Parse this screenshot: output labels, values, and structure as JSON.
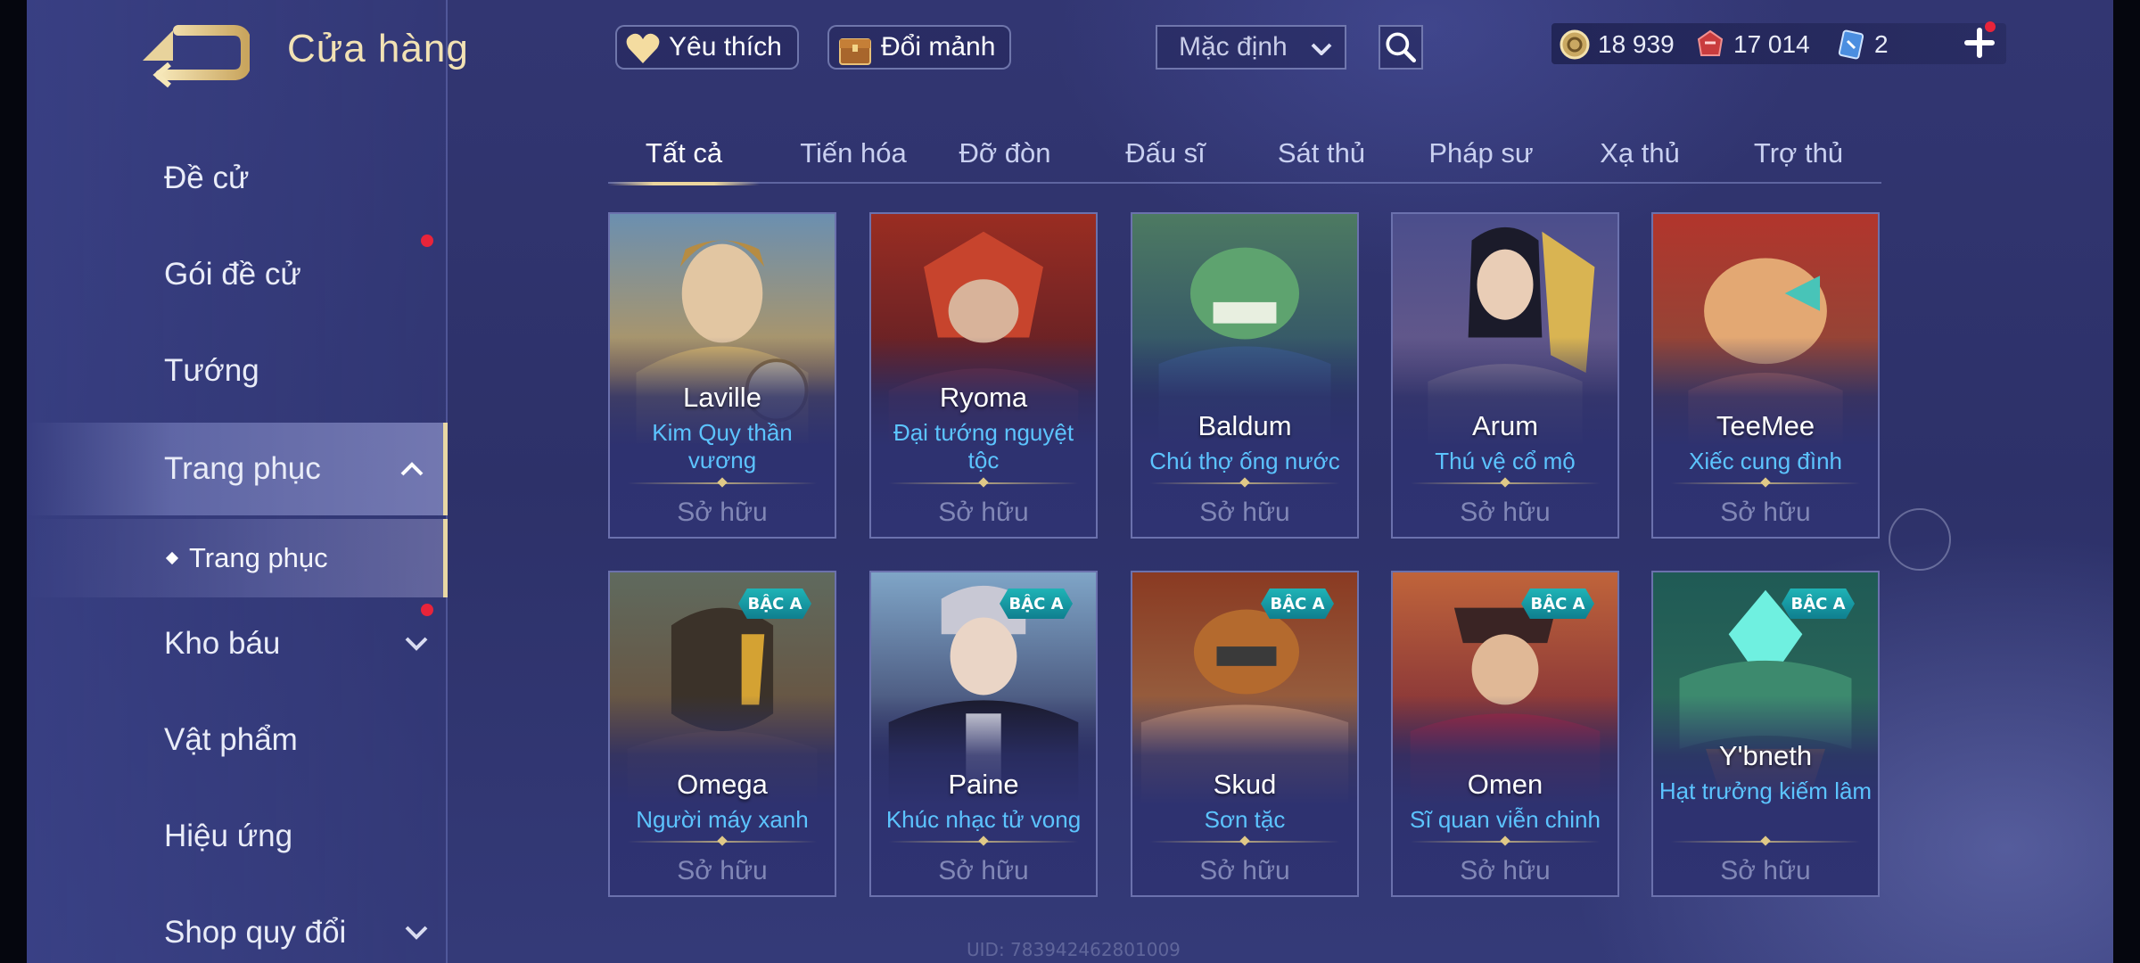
{
  "header": {
    "title": "Cửa hàng"
  },
  "sidebar": {
    "items": [
      {
        "label": "Đề cử"
      },
      {
        "label": "Gói đề cử"
      },
      {
        "label": "Tướng"
      },
      {
        "label": "Trang phục"
      },
      {
        "label": "Kho báu"
      },
      {
        "label": "Vật phẩm"
      },
      {
        "label": "Hiệu ứng"
      },
      {
        "label": "Shop quy đổi"
      }
    ],
    "sub_item": "Trang phục"
  },
  "topbar": {
    "favorite_label": "Yêu thích",
    "exchange_label": "Đổi mảnh",
    "sort_selected": "Mặc định"
  },
  "currencies": {
    "gold": "18 939",
    "vouchers": "17 014",
    "tickets": "2"
  },
  "tabs": [
    "Tất cả",
    "Tiến hóa",
    "Đỡ đòn",
    "Đấu sĩ",
    "Sát thủ",
    "Pháp sư",
    "Xạ thủ",
    "Trợ thủ"
  ],
  "skins": [
    {
      "hero": "Laville",
      "skin": "Kim Quy thần vương",
      "status": "Sở hữu"
    },
    {
      "hero": "Ryoma",
      "skin": "Đại tướng nguyệt tộc",
      "status": "Sở hữu"
    },
    {
      "hero": "Baldum",
      "skin": "Chú thợ ống nước",
      "status": "Sở hữu"
    },
    {
      "hero": "Arum",
      "skin": "Thú vệ cổ mộ",
      "status": "Sở hữu"
    },
    {
      "hero": "TeeMee",
      "skin": "Xiếc cung đình",
      "status": "Sở hữu"
    },
    {
      "hero": "Omega",
      "skin": "Người máy xanh",
      "status": "Sở hữu",
      "badge": "BẬC A"
    },
    {
      "hero": "Paine",
      "skin": "Khúc nhạc tử vong",
      "status": "Sở hữu",
      "badge": "BẬC A"
    },
    {
      "hero": "Skud",
      "skin": "Sơn tặc",
      "status": "Sở hữu",
      "badge": "BẬC A"
    },
    {
      "hero": "Omen",
      "skin": "Sĩ quan viễn chinh",
      "status": "Sở hữu",
      "badge": "BẬC A"
    },
    {
      "hero": "Y'bneth",
      "skin": "Hạt trưởng kiếm lâm",
      "status": "Sở hữu",
      "badge": "BẬC A"
    }
  ],
  "footer": {
    "uid": "UID: 783942462801009"
  },
  "colors": {
    "accent_gold": "#ecd79e",
    "skin_name_blue": "#5cc4ff",
    "badge_teal": "#1fb3b6",
    "notification_red": "#e8243a"
  },
  "icons": [
    "back-arrow-icon",
    "heart-icon",
    "chest-icon",
    "chevron-down-icon",
    "search-icon",
    "gold-coin-icon",
    "voucher-icon",
    "ticket-icon",
    "plus-icon"
  ]
}
